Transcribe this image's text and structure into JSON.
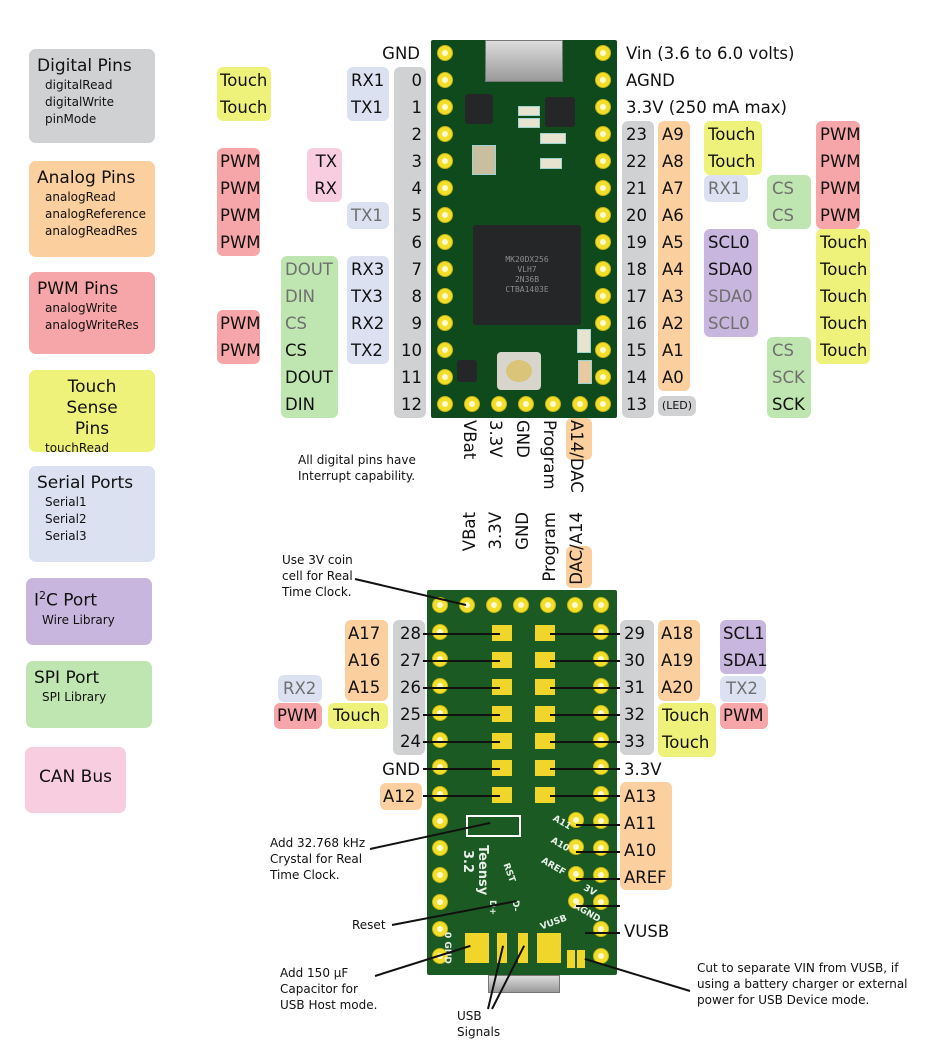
{
  "legend": [
    {
      "title": "Digital Pins",
      "items": [
        "digitalRead",
        "digitalWrite",
        "pinMode"
      ],
      "color": "#d0d1d2"
    },
    {
      "title": "Analog Pins",
      "items": [
        "analogRead",
        "analogReference",
        "analogReadRes"
      ],
      "color": "#fbcf9e"
    },
    {
      "title": "PWM Pins",
      "items": [
        "analogWrite",
        "analogWriteRes"
      ],
      "color": "#f6a5a8"
    },
    {
      "title": "Touch Sense Pins",
      "items": [
        "touchRead"
      ],
      "color": "#eff27a"
    },
    {
      "title": "Serial Ports",
      "items": [
        "Serial1",
        "Serial2",
        "Serial3"
      ],
      "color": "#dbe1f1"
    },
    {
      "title_prefix": "I",
      "title_sup": "2",
      "title_suffix": "C Port",
      "items": [
        "Wire Library"
      ],
      "color": "#c8b6de"
    },
    {
      "title": "SPI Port",
      "items": [
        "SPI Library"
      ],
      "color": "#bfe6b0"
    },
    {
      "title": "CAN Bus",
      "items": [],
      "color": "#f8cde0"
    }
  ],
  "top_left": {
    "gnd": "GND",
    "pins": [
      "0",
      "1",
      "2",
      "3",
      "4",
      "5",
      "6",
      "7",
      "8",
      "9",
      "10",
      "11",
      "12"
    ],
    "serial": [
      "RX1",
      "TX1",
      "",
      "",
      "",
      "TX1",
      "",
      "RX3",
      "TX3",
      "RX2",
      "TX2",
      "",
      ""
    ],
    "can": [
      "",
      "",
      "",
      "TX",
      "RX",
      "",
      "",
      "",
      "",
      "",
      "",
      "",
      ""
    ],
    "spi": [
      "",
      "",
      "",
      "",
      "",
      "",
      "",
      "DOUT",
      "DIN",
      "CS",
      "CS",
      "DOUT",
      "DIN"
    ],
    "pwm_touch": [
      "Touch",
      "Touch",
      "",
      "PWM",
      "PWM",
      "PWM",
      "PWM",
      "",
      "",
      "PWM",
      "PWM",
      "",
      ""
    ]
  },
  "top_right": {
    "power": [
      "Vin  (3.6 to 6.0 volts)",
      "AGND",
      "3.3V (250 mA max)"
    ],
    "pins": [
      "23",
      "22",
      "21",
      "20",
      "19",
      "18",
      "17",
      "16",
      "15",
      "14",
      "13"
    ],
    "analog": [
      "A9",
      "A8",
      "A7",
      "A6",
      "A5",
      "A4",
      "A3",
      "A2",
      "A1",
      "A0"
    ],
    "led": "(LED)",
    "col3": [
      "Touch",
      "Touch",
      "RX1",
      "",
      "SCL0",
      "SDA0",
      "SDA0",
      "SCL0",
      "",
      "",
      ""
    ],
    "spi": [
      "",
      "",
      "CS",
      "CS",
      "",
      "",
      "",
      "",
      "CS",
      "SCK",
      "SCK"
    ],
    "pwm_touch": [
      "PWM",
      "PWM",
      "PWM",
      "PWM",
      "Touch",
      "Touch",
      "Touch",
      "Touch",
      "Touch",
      "",
      ""
    ]
  },
  "top_bottom_labels": [
    "VBat",
    "3.3V",
    "GND",
    "Program",
    "A14/DAC"
  ],
  "interrupt_note": [
    "All digital pins have",
    "Interrupt capability."
  ],
  "bottom_top_labels": [
    "VBat",
    "3.3V",
    "GND",
    "Program",
    "DAC/A14"
  ],
  "bottom_left": {
    "pins": [
      "28",
      "27",
      "26",
      "25",
      "24"
    ],
    "analog": [
      "A17",
      "A16",
      "A15"
    ],
    "serial": "RX2",
    "pwm": "PWM",
    "touch": "Touch",
    "gnd": "GND",
    "a12": "A12"
  },
  "bottom_right": {
    "pins": [
      "29",
      "30",
      "31",
      "32",
      "33"
    ],
    "analog": [
      "A18",
      "A19",
      "A20"
    ],
    "i2c": [
      "SCL1",
      "SDA1"
    ],
    "serial": "TX2",
    "pwm": "PWM",
    "touch": [
      "Touch",
      "Touch"
    ],
    "v33": "3.3V",
    "analog2": [
      "A13",
      "A11",
      "A10",
      "AREF"
    ],
    "vusb": "VUSB"
  },
  "notes": {
    "coin_cell": [
      "Use 3V coin",
      "cell for Real",
      "Time Clock."
    ],
    "crystal": [
      "Add 32.768 kHz",
      "Crystal for Real",
      "Time Clock."
    ],
    "reset": "Reset",
    "capacitor": [
      "Add 150 µF",
      "Capacitor for",
      "USB Host mode."
    ],
    "usb_signals": [
      "USB",
      "Signals"
    ],
    "cut": [
      "Cut to separate VIN from VUSB, if",
      "using a battery charger or external",
      "power for USB Device mode."
    ]
  },
  "board": {
    "mcu_text": [
      "MK20DX256",
      "VLH7",
      "2N36B",
      "CTBA1403E"
    ],
    "silk_name": [
      "Teensy",
      "3.2"
    ],
    "silk_labels": [
      "RST",
      "D+",
      "D-",
      "VUSB",
      "AGND",
      "AREF",
      "A10",
      "A11",
      "3V",
      "0 GND"
    ]
  }
}
